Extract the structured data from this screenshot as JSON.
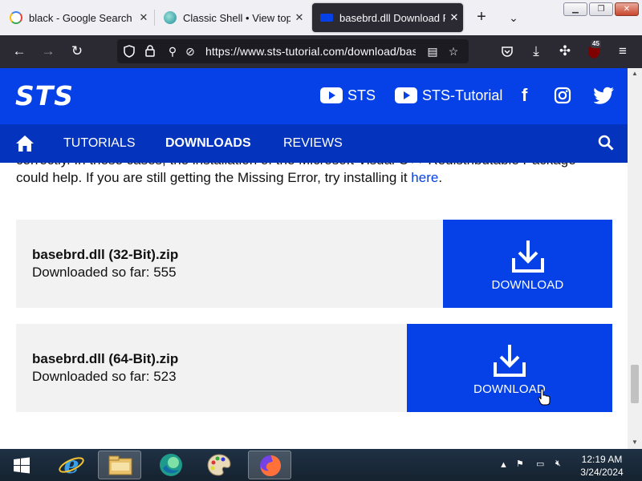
{
  "browser": {
    "tabs": [
      {
        "title": "black - Google Search",
        "active": false
      },
      {
        "title": "Classic Shell • View topic",
        "active": false
      },
      {
        "title": "basebrd.dll Download For",
        "active": true
      }
    ],
    "url": "https://www.sts-tutorial.com/download/basebrd",
    "notification_badge": "45",
    "colors": {
      "tab_bg": "#f0f0f4",
      "toolbar_bg": "#2b2a33"
    }
  },
  "site": {
    "logo": "STS",
    "social": {
      "youtube_1": "STS",
      "youtube_2": "STS-Tutorial"
    },
    "nav": {
      "tutorials": "TUTORIALS",
      "downloads": "DOWNLOADS",
      "reviews": "REVIEWS"
    },
    "colors": {
      "brand_blue": "#0541e6",
      "nav_blue": "#0434bd"
    }
  },
  "content": {
    "partial_line": "correctly. In these cases, the installation of the Microsoft Visual C++ Redistributable Package",
    "line_2_prefix": "could help. If you are still getting the Missing Error, try installing it ",
    "link_text": "here",
    "line_2_suffix": "."
  },
  "downloads": [
    {
      "name": "basebrd.dll (32-Bit).zip",
      "count_text": "Downloaded so far: 555",
      "button_label": "DOWNLOAD"
    },
    {
      "name": "basebrd.dll (64-Bit).zip",
      "count_text": "Downloaded so far: 523",
      "button_label": "DOWNLOAD"
    }
  ],
  "taskbar": {
    "time": "12:19 AM",
    "date": "3/24/2024"
  }
}
